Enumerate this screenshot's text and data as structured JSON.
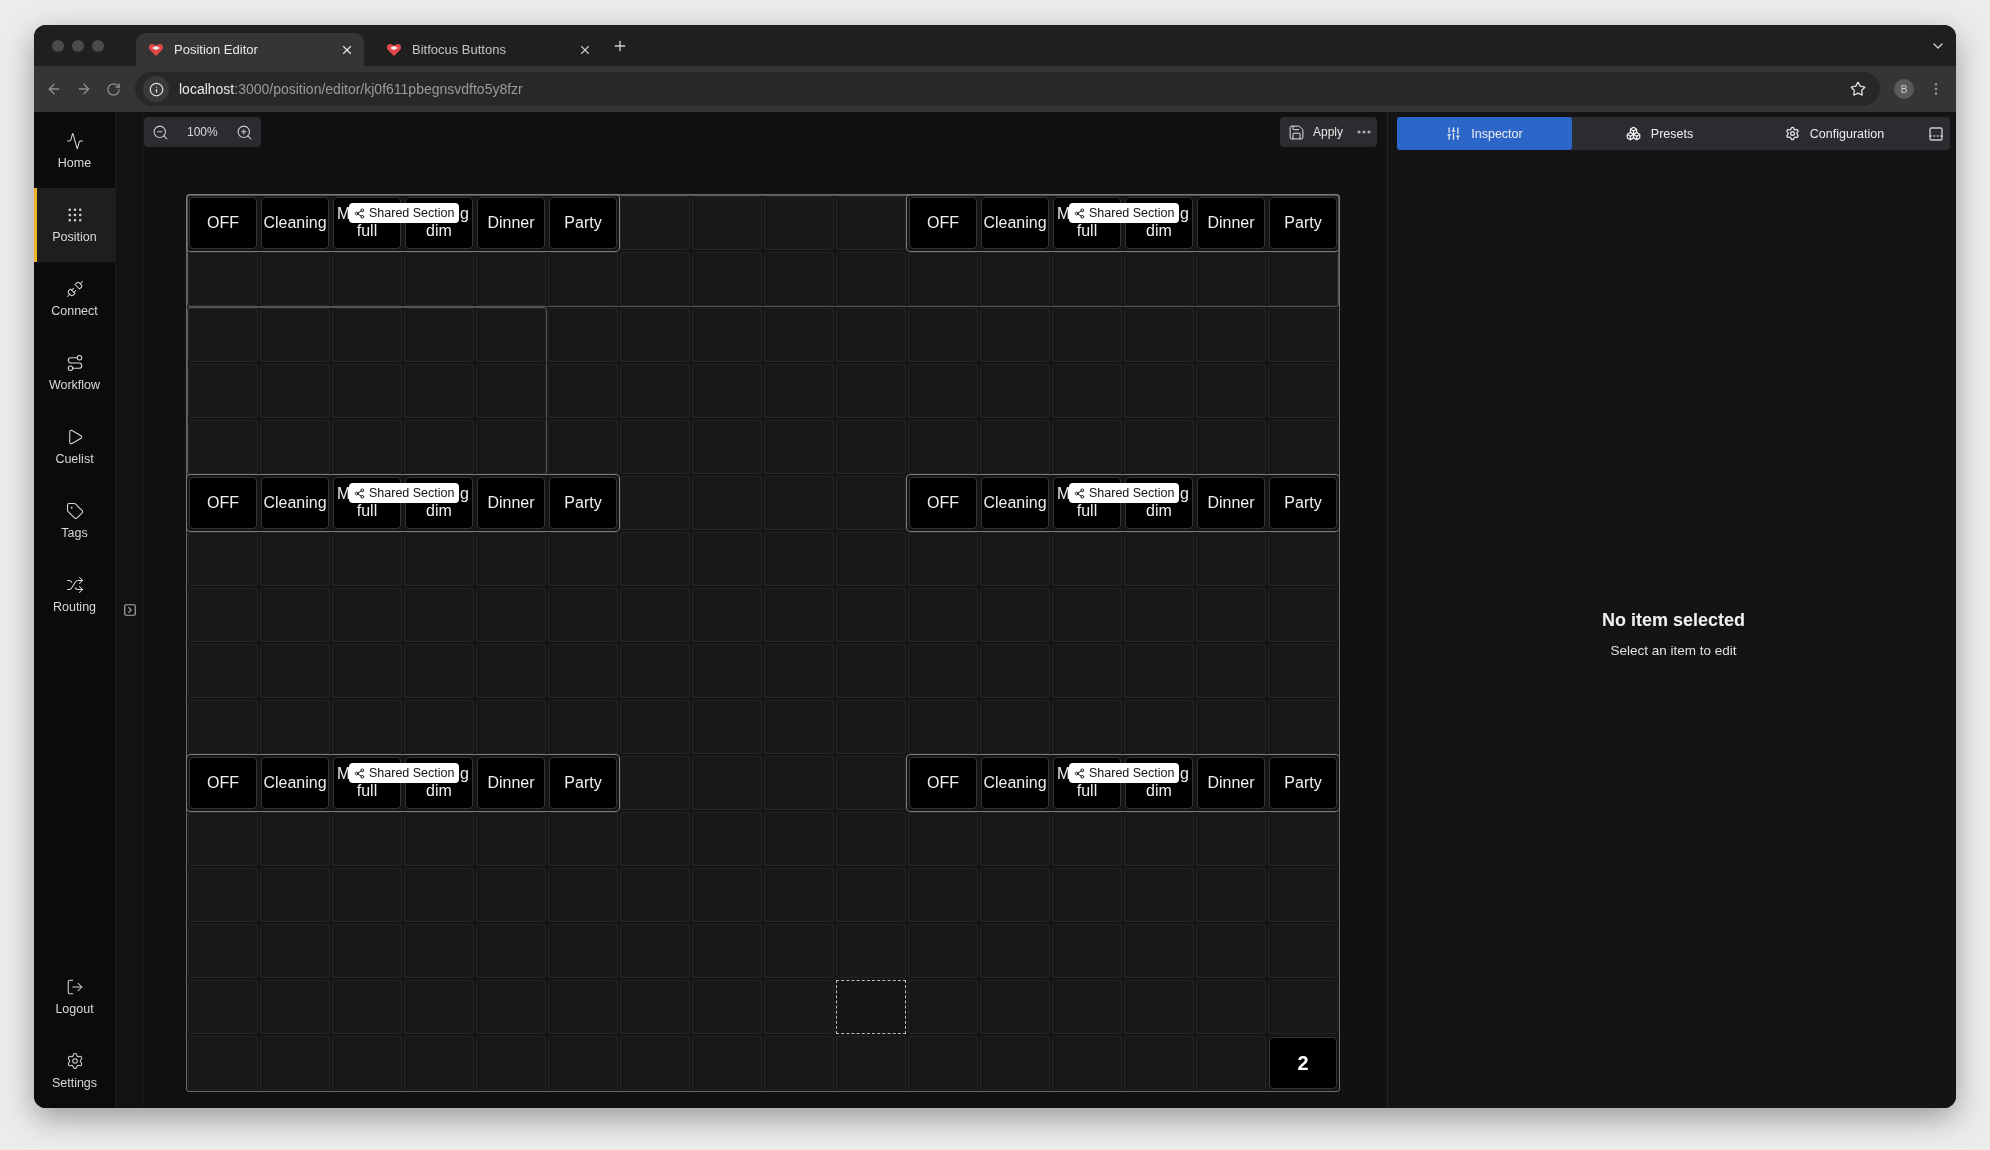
{
  "browser": {
    "tabs": [
      {
        "title": "Position Editor",
        "selected": true
      },
      {
        "title": "Bitfocus Buttons",
        "selected": false
      }
    ],
    "url_host": "localhost",
    "url_rest": ":3000/position/editor/kj0f611pbegnsvdfto5y8fzr",
    "profile": "B"
  },
  "sidebar": {
    "items": [
      {
        "label": "Home",
        "selected": false
      },
      {
        "label": "Position",
        "selected": true
      },
      {
        "label": "Connect",
        "selected": false
      },
      {
        "label": "Workflow",
        "selected": false
      },
      {
        "label": "Cuelist",
        "selected": false
      },
      {
        "label": "Tags",
        "selected": false
      },
      {
        "label": "Routing",
        "selected": false
      }
    ],
    "bottom": [
      {
        "label": "Logout",
        "selected": false
      },
      {
        "label": "Settings",
        "selected": false
      }
    ]
  },
  "toolbar": {
    "zoom": "100%",
    "apply": "Apply"
  },
  "canvas": {
    "sections": [
      {
        "badge": "Shared Section",
        "buttons": [
          {
            "lines": [
              "OFF"
            ]
          },
          {
            "lines": [
              "Cleaning"
            ]
          },
          {
            "lines": [
              "M",
              "full"
            ]
          },
          {
            "lines": [
              "g",
              "dim"
            ]
          },
          {
            "lines": [
              "Dinner"
            ]
          },
          {
            "lines": [
              "Party"
            ]
          }
        ]
      },
      {
        "badge": "Shared Section",
        "buttons": [
          {
            "lines": [
              "OFF"
            ]
          },
          {
            "lines": [
              "Cleaning"
            ]
          },
          {
            "lines": [
              "M",
              "full"
            ]
          },
          {
            "lines": [
              "g",
              "dim"
            ]
          },
          {
            "lines": [
              "Dinner"
            ]
          },
          {
            "lines": [
              "Party"
            ]
          }
        ]
      },
      {
        "badge": "Shared Section",
        "buttons": [
          {
            "lines": [
              "OFF"
            ]
          },
          {
            "lines": [
              "Cleaning"
            ]
          },
          {
            "lines": [
              "M",
              "full"
            ]
          },
          {
            "lines": [
              "g",
              "dim"
            ]
          },
          {
            "lines": [
              "Dinner"
            ]
          },
          {
            "lines": [
              "Party"
            ]
          }
        ]
      },
      {
        "badge": "Shared Section",
        "buttons": [
          {
            "lines": [
              "OFF"
            ]
          },
          {
            "lines": [
              "Cleaning"
            ]
          },
          {
            "lines": [
              "M",
              "full"
            ]
          },
          {
            "lines": [
              "g",
              "dim"
            ]
          },
          {
            "lines": [
              "Dinner"
            ]
          },
          {
            "lines": [
              "Party"
            ]
          }
        ]
      },
      {
        "badge": "Shared Section",
        "buttons": [
          {
            "lines": [
              "OFF"
            ]
          },
          {
            "lines": [
              "Cleaning"
            ]
          },
          {
            "lines": [
              "M",
              "full"
            ]
          },
          {
            "lines": [
              "g",
              "dim"
            ]
          },
          {
            "lines": [
              "Dinner"
            ]
          },
          {
            "lines": [
              "Party"
            ]
          }
        ]
      },
      {
        "badge": "Shared Section",
        "buttons": [
          {
            "lines": [
              "OFF"
            ]
          },
          {
            "lines": [
              "Cleaning"
            ]
          },
          {
            "lines": [
              "M",
              "full"
            ]
          },
          {
            "lines": [
              "g",
              "dim"
            ]
          },
          {
            "lines": [
              "Dinner"
            ]
          },
          {
            "lines": [
              "Party"
            ]
          }
        ]
      }
    ],
    "page_button": "2"
  },
  "inspector": {
    "tabs": [
      {
        "label": "Inspector",
        "selected": true
      },
      {
        "label": "Presets",
        "selected": false
      },
      {
        "label": "Configuration",
        "selected": false
      }
    ],
    "empty_title": "No item selected",
    "empty_hint": "Select an item to edit"
  }
}
